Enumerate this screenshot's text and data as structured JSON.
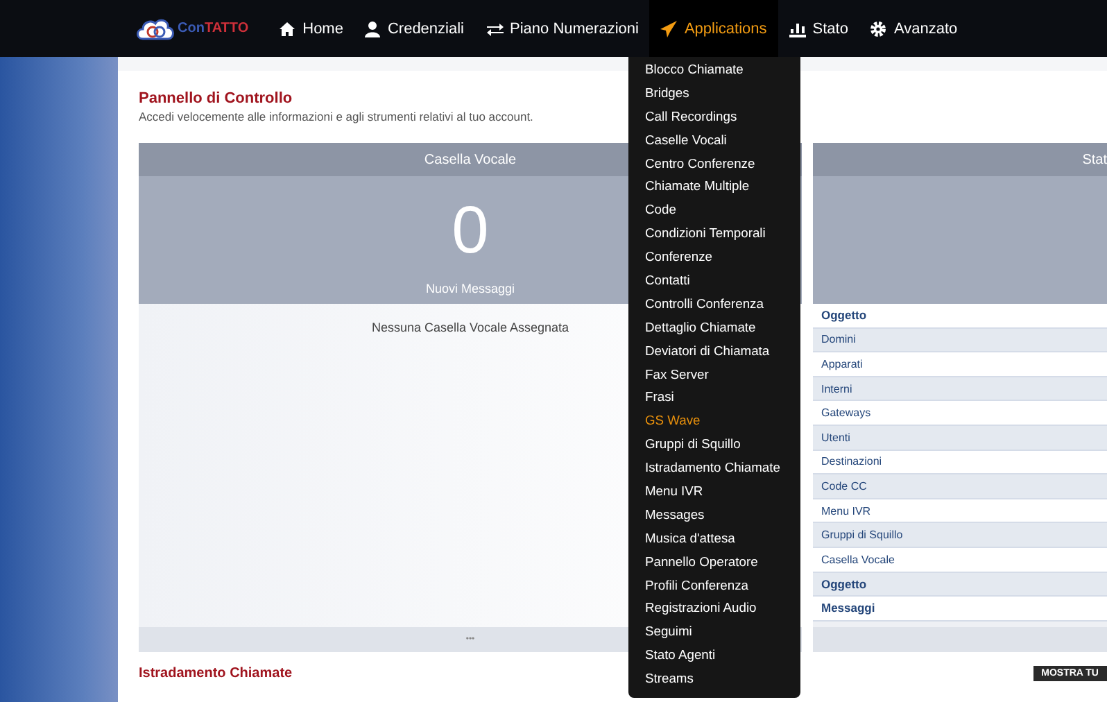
{
  "nav": {
    "logo_text_left": "Con",
    "logo_text_right": "TATTO",
    "items": [
      {
        "label": "Home",
        "selected": false
      },
      {
        "label": "Credenziali",
        "selected": false
      },
      {
        "label": "Piano Numerazioni",
        "selected": false
      },
      {
        "label": "Applications",
        "selected": true
      },
      {
        "label": "Stato",
        "selected": false
      },
      {
        "label": "Avanzato",
        "selected": false
      }
    ]
  },
  "dropdown": {
    "items": [
      {
        "label": "Blocco Chiamate",
        "selected": false
      },
      {
        "label": "Bridges",
        "selected": false
      },
      {
        "label": "Call Recordings",
        "selected": false
      },
      {
        "label": "Caselle Vocali",
        "selected": false
      },
      {
        "label": "Centro Conferenze",
        "selected": false
      },
      {
        "label": "Chiamate Multiple",
        "selected": false
      },
      {
        "label": "Code",
        "selected": false
      },
      {
        "label": "Condizioni Temporali",
        "selected": false
      },
      {
        "label": "Conferenze",
        "selected": false
      },
      {
        "label": "Contatti",
        "selected": false
      },
      {
        "label": "Controlli Conferenza",
        "selected": false
      },
      {
        "label": "Dettaglio Chiamate",
        "selected": false
      },
      {
        "label": "Deviatori di Chiamata",
        "selected": false
      },
      {
        "label": "Fax Server",
        "selected": false
      },
      {
        "label": "Frasi",
        "selected": false
      },
      {
        "label": "GS Wave",
        "selected": true
      },
      {
        "label": "Gruppi di Squillo",
        "selected": false
      },
      {
        "label": "Istradamento Chiamate",
        "selected": false
      },
      {
        "label": "Menu IVR",
        "selected": false
      },
      {
        "label": "Messages",
        "selected": false
      },
      {
        "label": "Musica d'attesa",
        "selected": false
      },
      {
        "label": "Pannello Operatore",
        "selected": false
      },
      {
        "label": "Profili Conferenza",
        "selected": false
      },
      {
        "label": "Registrazioni Audio",
        "selected": false
      },
      {
        "label": "Seguimi",
        "selected": false
      },
      {
        "label": "Stato Agenti",
        "selected": false
      },
      {
        "label": "Streams",
        "selected": false
      }
    ]
  },
  "page": {
    "title": "Pannello di Controllo",
    "subtitle": "Accedi velocemente alle informazioni e agli strumenti relativi al tuo account."
  },
  "voicemail_panel": {
    "title": "Casella Vocale",
    "count": "0",
    "count_label": "Nuovi Messaggi",
    "empty_message": "Nessuna Casella Vocale Assegnata",
    "footer": "•••"
  },
  "status_panel": {
    "title": "Stat",
    "rows": [
      {
        "label": "Oggetto",
        "kind": "header"
      },
      {
        "label": "Domini",
        "kind": "row"
      },
      {
        "label": "Apparati",
        "kind": "row"
      },
      {
        "label": "Interni",
        "kind": "row"
      },
      {
        "label": "Gateways",
        "kind": "row"
      },
      {
        "label": "Utenti",
        "kind": "row"
      },
      {
        "label": "Destinazioni",
        "kind": "row"
      },
      {
        "label": "Code CC",
        "kind": "row"
      },
      {
        "label": "Menu IVR",
        "kind": "row"
      },
      {
        "label": "Gruppi di Squillo",
        "kind": "row"
      },
      {
        "label": "Casella Vocale",
        "kind": "row"
      },
      {
        "label": "Oggetto",
        "kind": "header"
      },
      {
        "label": "Messaggi",
        "kind": "header"
      }
    ]
  },
  "next_section": {
    "title": "Istradamento Chiamate",
    "button": "MOSTRA TU"
  }
}
